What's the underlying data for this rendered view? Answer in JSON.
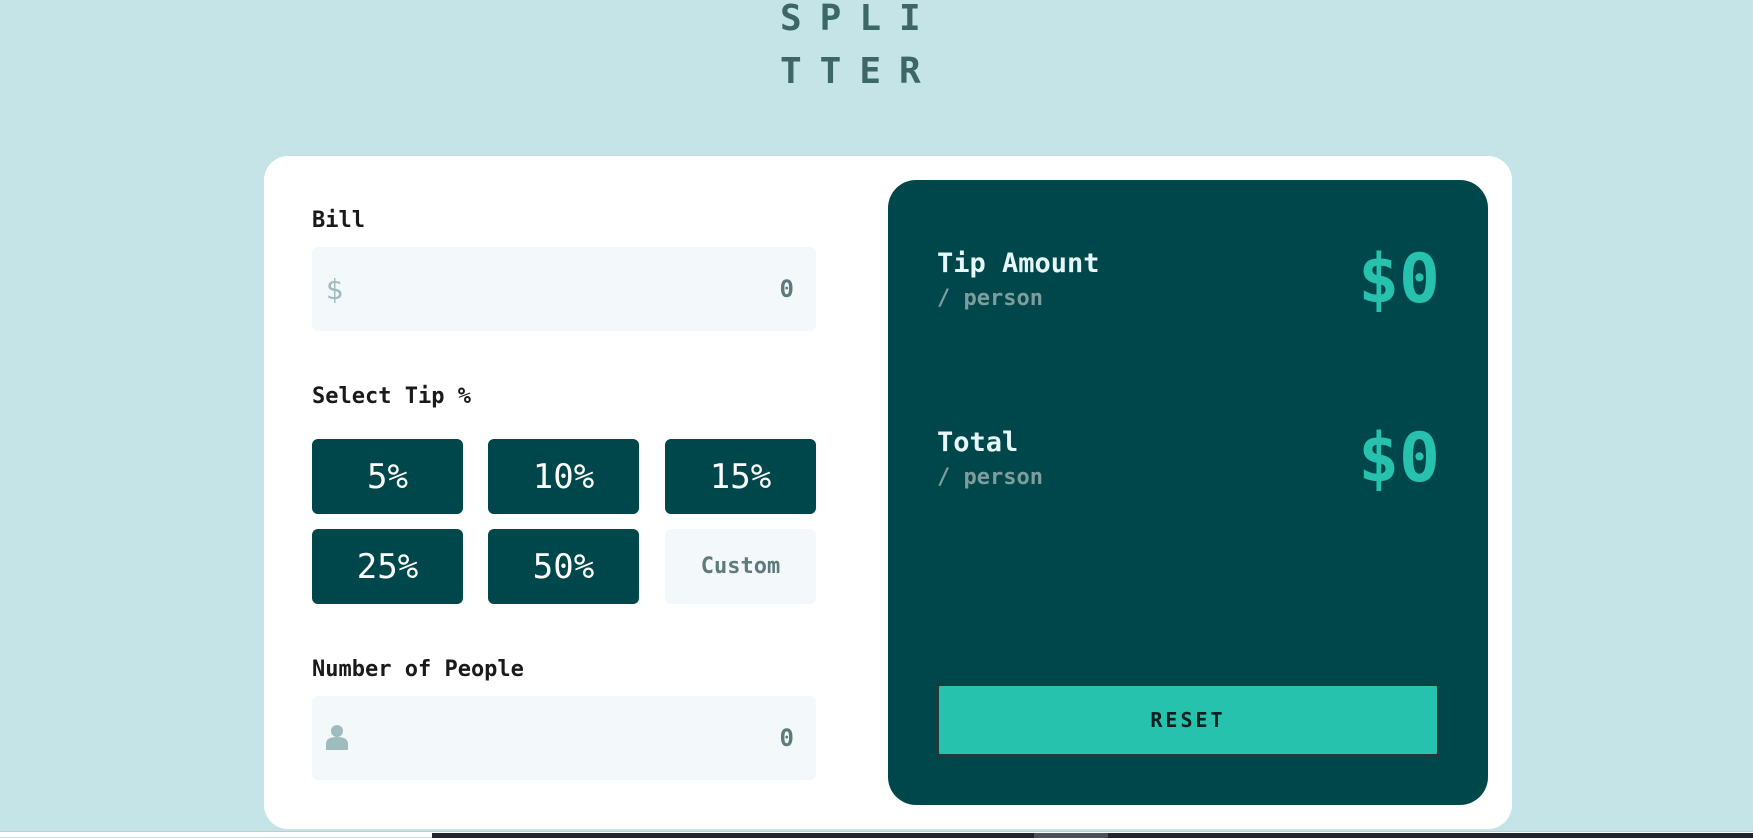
{
  "logo": {
    "line1": "SPLI",
    "line2": "TTER"
  },
  "bill": {
    "label": "Bill",
    "currency_symbol": "$",
    "placeholder": "0"
  },
  "tip": {
    "label": "Select Tip %",
    "options": [
      "5%",
      "10%",
      "15%",
      "25%",
      "50%"
    ],
    "custom_placeholder": "Custom"
  },
  "people": {
    "label": "Number of People",
    "placeholder": "0",
    "icon": "person-icon"
  },
  "results": {
    "tip_amount": {
      "title": "Tip Amount",
      "sub": "/ person",
      "value": "$0"
    },
    "total": {
      "title": "Total",
      "sub": "/ person",
      "value": "$0"
    },
    "reset_label": "RESET"
  },
  "colors": {
    "background": "#c5e4e7",
    "dark_cyan": "#00474b",
    "strong_cyan": "#26c2ae",
    "input_bg": "#f3f8fb"
  }
}
